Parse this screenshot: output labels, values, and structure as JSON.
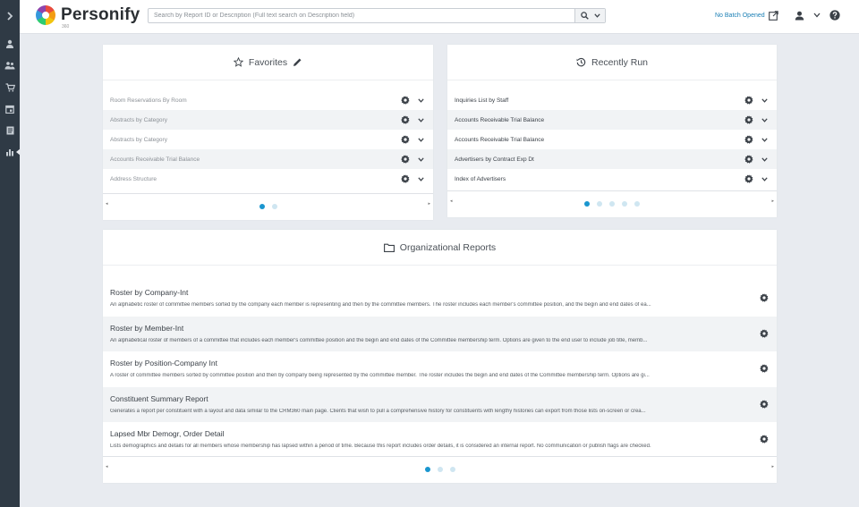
{
  "app": {
    "brand": "Personify",
    "brand_sub": "360"
  },
  "search": {
    "placeholder": "Search by Report ID or Description (Full text search on Description field)"
  },
  "header": {
    "batch_status": "No Batch Opened"
  },
  "favorites": {
    "title": "Favorites",
    "items": [
      {
        "label": "Room Reservations By Room"
      },
      {
        "label": "Abstracts by Category"
      },
      {
        "label": "Abstracts by Category"
      },
      {
        "label": "Accounts Receivable Trial Balance"
      },
      {
        "label": "Address Structure"
      }
    ],
    "pages": 2,
    "current_page": 1
  },
  "recent": {
    "title": "Recently Run",
    "items": [
      {
        "label": "Inquiries List by Staff"
      },
      {
        "label": "Accounts Receivable Trial Balance"
      },
      {
        "label": "Accounts Receivable Trial Balance"
      },
      {
        "label": "Advertisers by Contract Exp Dt"
      },
      {
        "label": "Index of Advertisers"
      }
    ],
    "pages": 5,
    "current_page": 1
  },
  "org": {
    "title": "Organizational Reports",
    "items": [
      {
        "title": "Roster by Company-Int",
        "desc": "An alphabetic roster of committee members sorted by the company each member is representing and then by the committee members. The roster includes each member's committee position, and the begin and end dates of ea..."
      },
      {
        "title": "Roster by Member-Int",
        "desc": "An alphabetical roster of members of a committee that includes each member's committee position and the begin and end dates of the Committee membership term. Options are given to the end user to include job title, memb..."
      },
      {
        "title": "Roster by Position-Company Int",
        "desc": "A roster of committee members sorted by committee position and then by company being represented by the committee member. The roster includes the begin and end dates of the Committee membership term. Options are gi..."
      },
      {
        "title": "Constituent Summary Report",
        "desc": "Generates a report per constituent with a layout and data similar to the CRM360 main page. Clients that wish to pull a comprehensive history for constituents with lengthy histories can export from those lists on-screen or crea..."
      },
      {
        "title": "Lapsed Mbr Demogr, Order Detail",
        "desc": "Lists demographics and details for all members whose membership has lapsed within a period of time. Because this report includes order details, it is considered an internal report. No communication or publish flags are checked."
      }
    ],
    "pages": 3,
    "current_page": 1
  },
  "pager": {
    "prev": "◂",
    "next": "▸"
  },
  "sidebar": {
    "icons": [
      "expand-icon",
      "person-icon",
      "people-icon",
      "cart-icon",
      "calendar-icon",
      "document-icon",
      "bar-chart-icon"
    ]
  },
  "colors": {
    "rail": "#2f3a45",
    "accent": "#1a96cf",
    "link": "#1a7fb5",
    "background": "#e8ebf0"
  }
}
